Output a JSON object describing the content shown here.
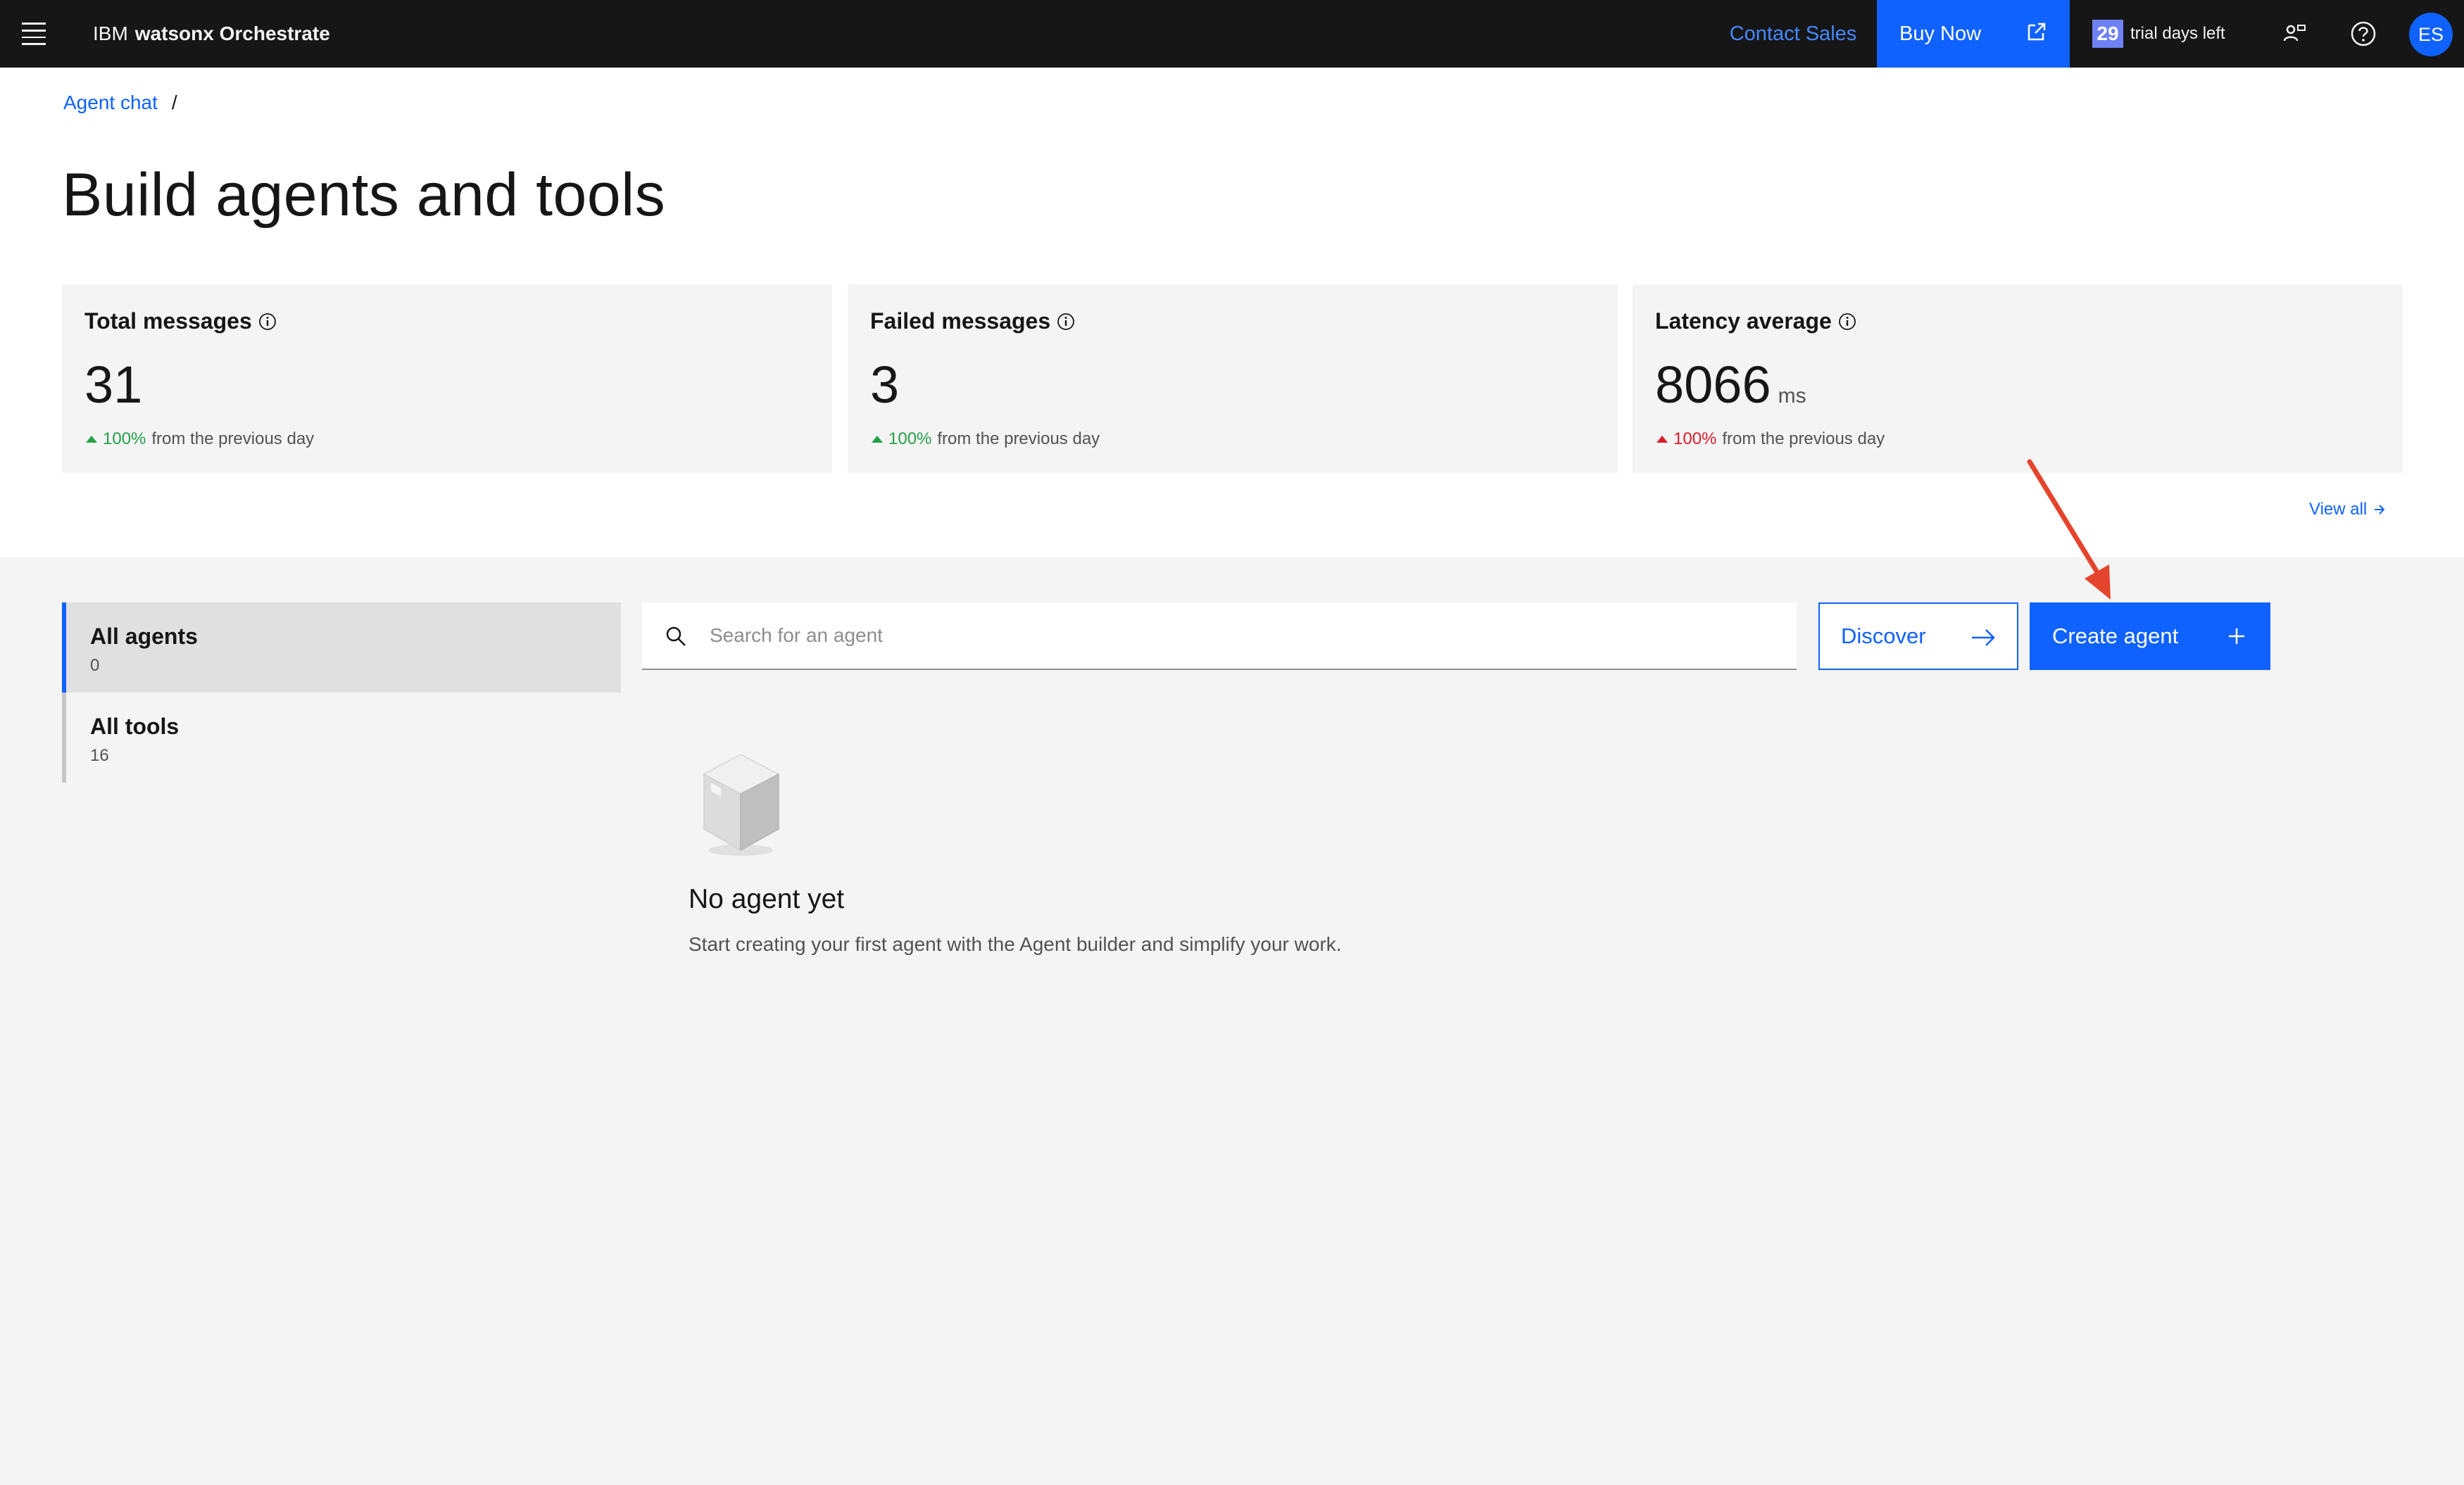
{
  "topbar": {
    "brand_prefix": "IBM",
    "brand_name": "watsonx Orchestrate",
    "contact_sales": "Contact Sales",
    "buy_now": "Buy Now",
    "trial_days": "29",
    "trial_label": "trial days left",
    "avatar_initials": "ES"
  },
  "breadcrumb": {
    "link": "Agent chat",
    "separator": "/"
  },
  "page_title": "Build agents and tools",
  "metrics": [
    {
      "label": "Total messages",
      "value": "31",
      "unit": "",
      "change_pct": "100%",
      "change_text": "from the previous day",
      "trend": "up",
      "trend_color": "#24a148"
    },
    {
      "label": "Failed messages",
      "value": "3",
      "unit": "",
      "change_pct": "100%",
      "change_text": "from the previous day",
      "trend": "up",
      "trend_color": "#24a148"
    },
    {
      "label": "Latency average",
      "value": "8066",
      "unit": "ms",
      "change_pct": "100%",
      "change_text": "from the previous day",
      "trend": "up",
      "trend_color": "#da1e28"
    }
  ],
  "view_all": "View all",
  "sidebar": {
    "items": [
      {
        "label": "All agents",
        "count": "0",
        "active": true
      },
      {
        "label": "All tools",
        "count": "16",
        "active": false
      }
    ]
  },
  "search": {
    "placeholder": "Search for an agent",
    "value": ""
  },
  "actions": {
    "discover": "Discover",
    "create_agent": "Create agent"
  },
  "empty_state": {
    "title": "No agent yet",
    "description": "Start creating your first agent with the Agent builder and simplify your work."
  },
  "colors": {
    "accent": "#0f62fe",
    "topbar_bg": "#161616",
    "positive": "#24a148",
    "negative": "#da1e28",
    "annotation_arrow": "#e5442c"
  }
}
